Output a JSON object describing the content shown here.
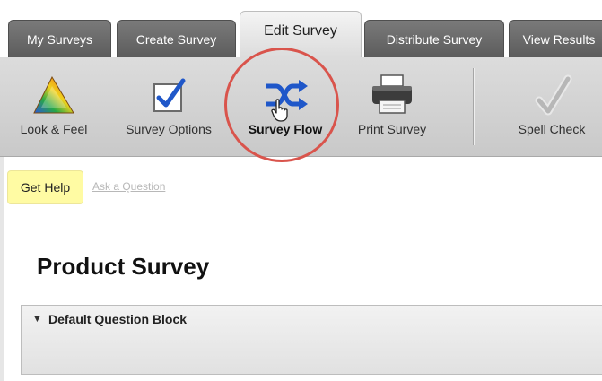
{
  "tabs": [
    {
      "label": "My Surveys",
      "active": false
    },
    {
      "label": "Create Survey",
      "active": false
    },
    {
      "label": "Edit Survey",
      "active": true
    },
    {
      "label": "Distribute Survey",
      "active": false
    },
    {
      "label": "View Results",
      "active": false
    }
  ],
  "toolbar": {
    "items": [
      {
        "label": "Look & Feel",
        "icon": "rainbow-triangle-icon"
      },
      {
        "label": "Survey Options",
        "icon": "checkbox-icon"
      },
      {
        "label": "Survey Flow",
        "icon": "shuffle-arrows-icon",
        "highlighted": true
      },
      {
        "label": "Print Survey",
        "icon": "printer-icon"
      },
      {
        "label": "Spell Check",
        "icon": "checkmark-icon"
      }
    ]
  },
  "help": {
    "get_help": "Get Help",
    "ask_question": "Ask a Question"
  },
  "survey": {
    "title": "Product Survey",
    "block_toggle": "▼",
    "block_title": "Default Question Block"
  },
  "colors": {
    "highlight_ring": "#d9544c",
    "help_button_bg": "#fffba3",
    "flow_icon": "#1f57c9"
  }
}
